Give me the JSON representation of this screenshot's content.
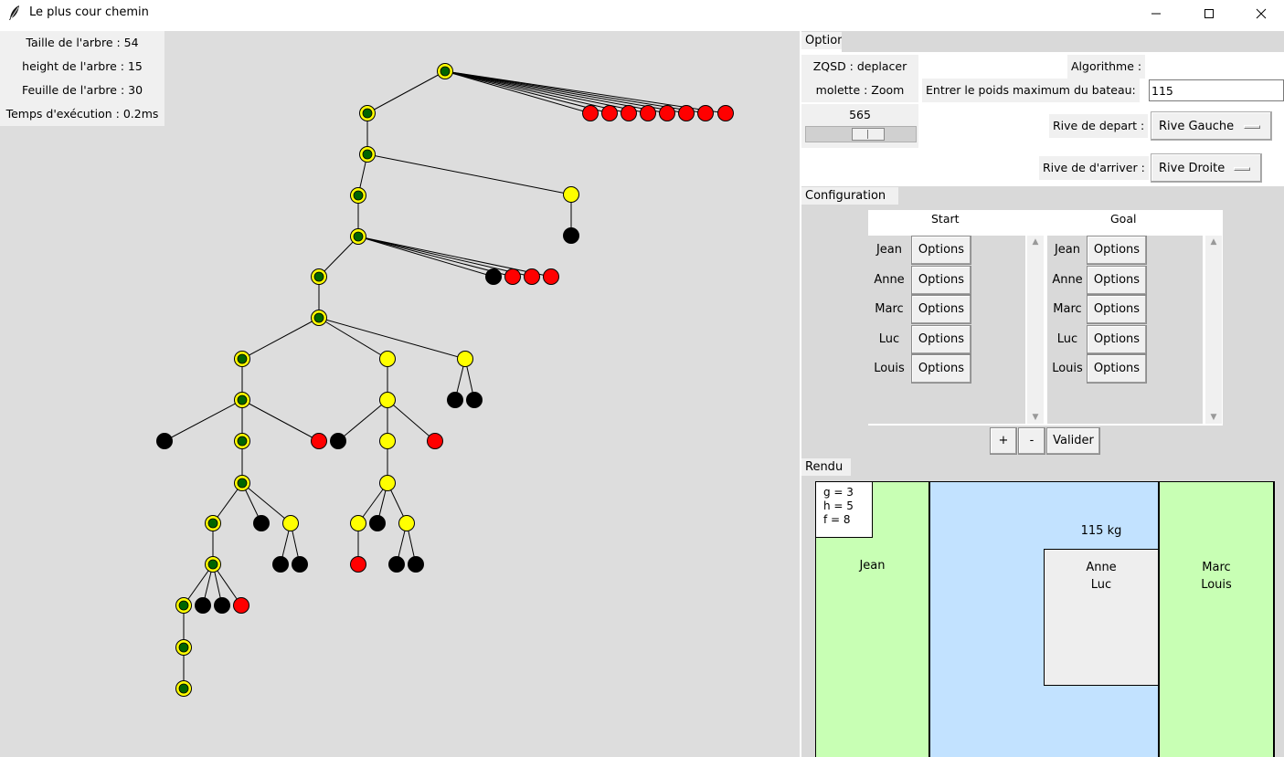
{
  "window": {
    "title": "Le plus cour chemin",
    "icons": {
      "app": "feather-icon",
      "minimize": "minimize-icon",
      "maximize": "maximize-icon",
      "close": "close-icon"
    }
  },
  "stats": {
    "tree_size": "Taille de l'arbre  : 54",
    "tree_height": "height de l'arbre : 15",
    "leaves": "Feuille de l'arbre : 30",
    "exec_time": "Temps d'exécution : 0.2ms"
  },
  "colors": {
    "canvas_bg": "#dddddd",
    "node_yellow": "#ffff00",
    "node_green": "#006400",
    "node_red": "#ff0000",
    "node_black": "#000000",
    "bank": "#c8ffb4",
    "river": "#c2e2ff",
    "boat": "#eeeeee"
  },
  "option": {
    "section_label": "Option",
    "hint_move": "ZQSD : deplacer",
    "hint_zoom": "molette : Zoom",
    "algorithm_label": "Algorithme :",
    "algorithm_value": "",
    "weight_label": "Entrer le poids maximum du bateau:",
    "weight_value": "115",
    "slider_value": "565",
    "depart_label": "Rive de depart :",
    "depart_value": "Rive Gauche",
    "arrivee_label": "Rive de d'arriver :",
    "arrivee_value": "Rive Droite"
  },
  "configuration": {
    "section_label": "Configuration",
    "start_header": "Start",
    "goal_header": "Goal",
    "option_button": "Options",
    "start_people": [
      "Jean",
      "Anne",
      "Marc",
      "Luc",
      "Louis"
    ],
    "goal_people": [
      "Jean",
      "Anne",
      "Marc",
      "Luc",
      "Louis"
    ],
    "add_button": "+",
    "remove_button": "-",
    "validate_button": "Valider"
  },
  "rendu": {
    "section_label": "Rendu",
    "g": "g = 3",
    "h": "h = 5",
    "f": "f = 8",
    "left_bank": "Jean",
    "boat_weight": "115 kg",
    "boat_line1": "Anne",
    "boat_line2": "Luc",
    "right_bank_line1": "Marc",
    "right_bank_line2": "Louis"
  }
}
